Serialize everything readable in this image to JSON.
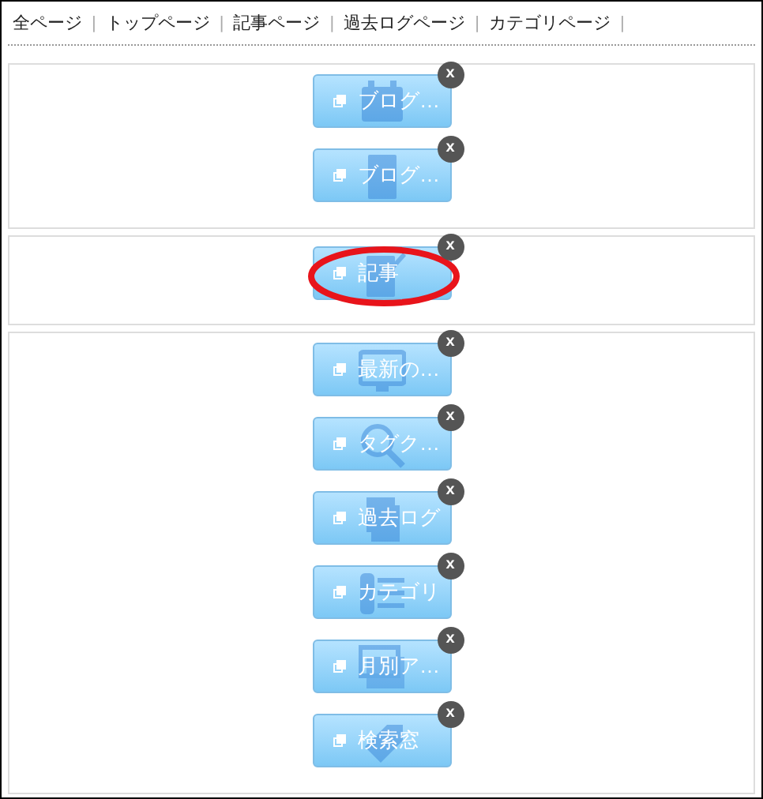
{
  "nav": [
    "全ページ",
    "トップページ",
    "記事ページ",
    "過去ログページ",
    "カテゴリページ"
  ],
  "nav_separator": "|",
  "sections": [
    {
      "widgets": [
        {
          "label": "ブログ…",
          "kind": "calendar",
          "close": "x",
          "highlighted": false
        },
        {
          "label": "ブログ…",
          "kind": "document",
          "close": "x",
          "highlighted": false
        }
      ]
    },
    {
      "widgets": [
        {
          "label": "記事",
          "kind": "document-pen",
          "close": "x",
          "highlighted": true
        }
      ]
    },
    {
      "widgets": [
        {
          "label": "最新の…",
          "kind": "monitor",
          "close": "x",
          "highlighted": false
        },
        {
          "label": "タグク…",
          "kind": "search",
          "close": "x",
          "highlighted": false
        },
        {
          "label": "過去ログ",
          "kind": "stack",
          "close": "x",
          "highlighted": false
        },
        {
          "label": "カテゴリ",
          "kind": "list",
          "close": "x",
          "highlighted": false
        },
        {
          "label": "月別ア…",
          "kind": "layers",
          "close": "x",
          "highlighted": false
        },
        {
          "label": "検索窓",
          "kind": "tag",
          "close": "x",
          "highlighted": false
        }
      ]
    }
  ]
}
